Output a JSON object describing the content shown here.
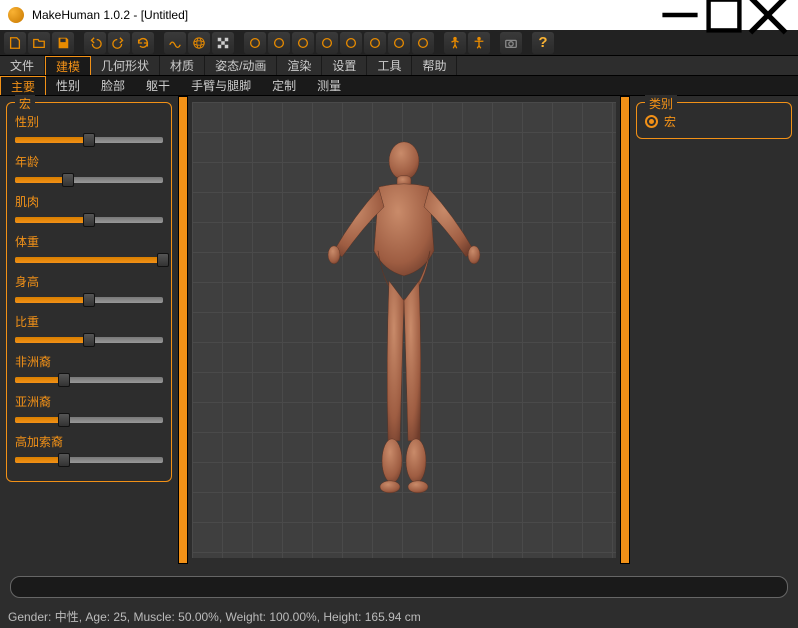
{
  "window": {
    "title": "MakeHuman 1.0.2 - [Untitled]"
  },
  "toolbar_icons": [
    "new-file",
    "open-file",
    "save-file",
    "sep",
    "undo",
    "redo",
    "refresh",
    "sep",
    "smooth",
    "wireframe",
    "checker",
    "sep",
    "cam-front",
    "cam-back",
    "cam-left",
    "cam-right",
    "cam-top",
    "cam-bottom",
    "cam-persp",
    "cam-ortho",
    "sep",
    "pose-a",
    "pose-t",
    "sep",
    "camera",
    "sep",
    "help"
  ],
  "menu_main": [
    "文件",
    "建模",
    "几何形状",
    "材质",
    "姿态/动画",
    "渲染",
    "设置",
    "工具",
    "帮助"
  ],
  "menu_main_active": 1,
  "menu_sub": [
    "主要",
    "性别",
    "脸部",
    "躯干",
    "手臂与腿脚",
    "定制",
    "测量"
  ],
  "menu_sub_active": 0,
  "left_panel": {
    "title": "宏",
    "params": [
      {
        "label": "性别",
        "value": 50
      },
      {
        "label": "年龄",
        "value": 36
      },
      {
        "label": "肌肉",
        "value": 50
      },
      {
        "label": "体重",
        "value": 100
      },
      {
        "label": "身高",
        "value": 50
      },
      {
        "label": "比重",
        "value": 50
      },
      {
        "label": "非洲裔",
        "value": 33
      },
      {
        "label": "亚洲裔",
        "value": 33
      },
      {
        "label": "高加索裔",
        "value": 33
      }
    ]
  },
  "right_panel": {
    "title": "类别",
    "option": "宏"
  },
  "status": {
    "gender_label": "Gender:",
    "gender_value": "中性",
    "age_label": "Age:",
    "age_value": "25",
    "muscle_label": "Muscle:",
    "muscle_value": "50.00%",
    "weight_label": "Weight:",
    "weight_value": "100.00%",
    "height_label": "Height:",
    "height_value": "165.94 cm"
  }
}
